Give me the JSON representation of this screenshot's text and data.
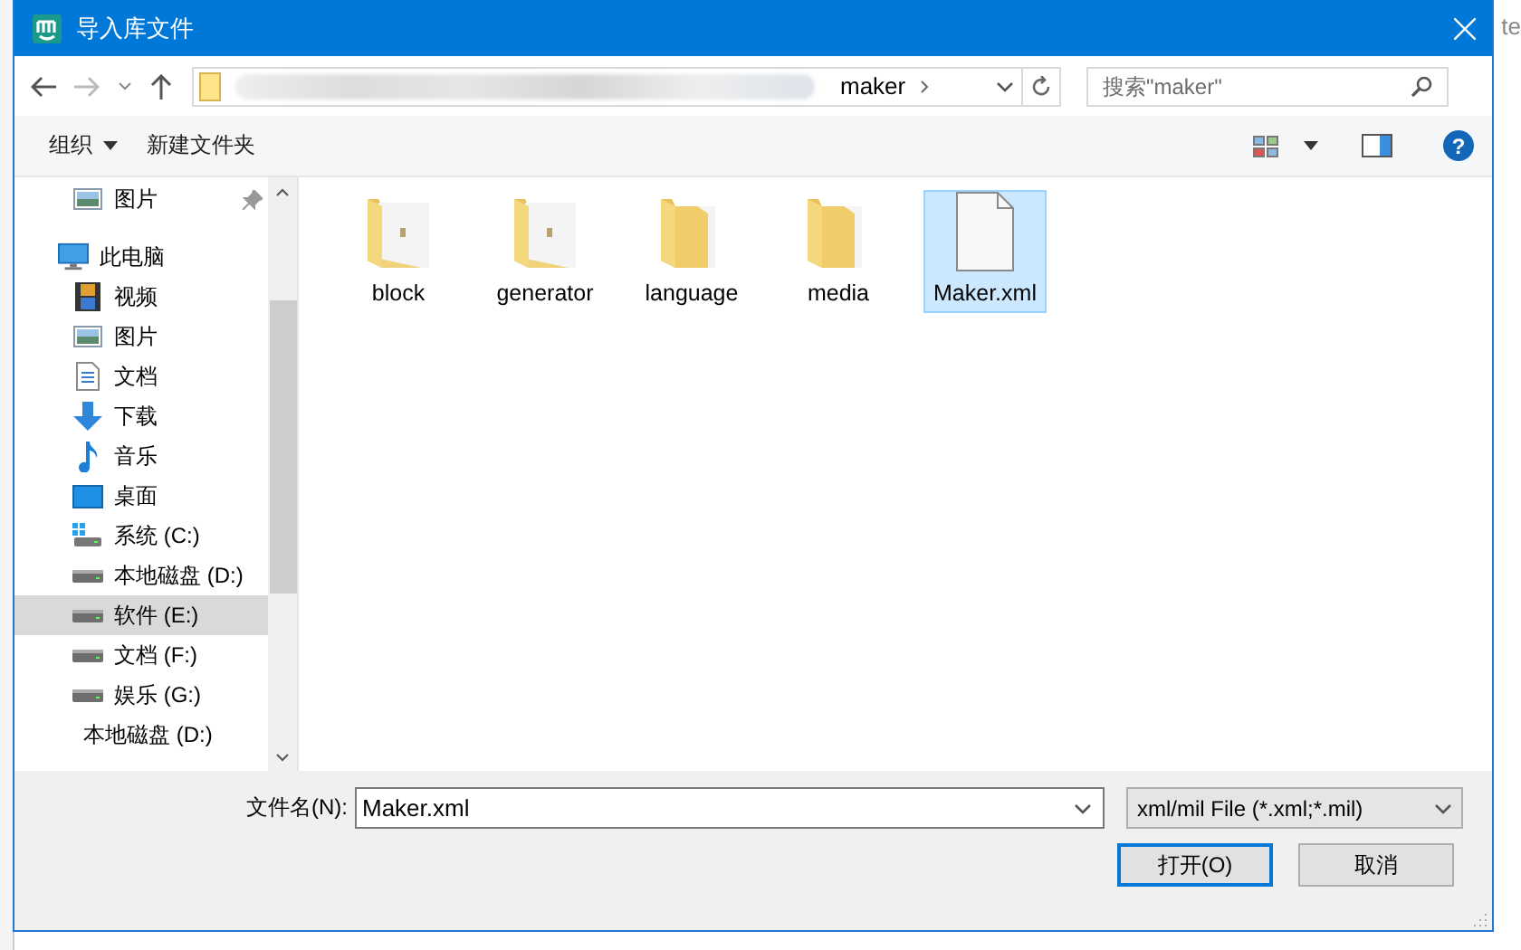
{
  "window": {
    "title": "导入库文件"
  },
  "background_text": "te",
  "address": {
    "current": "maker"
  },
  "search": {
    "placeholder": "搜索\"maker\""
  },
  "toolbar": {
    "organize": "组织",
    "new_folder": "新建文件夹",
    "help": "?"
  },
  "nav": [
    {
      "label": "图片",
      "kind": "picture",
      "pinned": true,
      "selected": false
    },
    {
      "label": "此电脑",
      "kind": "pc",
      "pinned": false,
      "selected": false,
      "children": [
        {
          "label": "视频",
          "kind": "video",
          "pinned": false,
          "selected": false
        },
        {
          "label": "图片",
          "kind": "picture",
          "pinned": false,
          "selected": false
        },
        {
          "label": "文档",
          "kind": "document",
          "pinned": false,
          "selected": false
        },
        {
          "label": "下载",
          "kind": "download",
          "pinned": false,
          "selected": false
        },
        {
          "label": "音乐",
          "kind": "music",
          "pinned": false,
          "selected": false
        },
        {
          "label": "桌面",
          "kind": "desktop",
          "pinned": false,
          "selected": false
        },
        {
          "label": "系统 (C:)",
          "kind": "system-drive",
          "pinned": false,
          "selected": false
        },
        {
          "label": "本地磁盘 (D:)",
          "kind": "drive",
          "pinned": false,
          "selected": false
        },
        {
          "label": "软件 (E:)",
          "kind": "drive",
          "pinned": false,
          "selected": true
        },
        {
          "label": "文档 (F:)",
          "kind": "drive",
          "pinned": false,
          "selected": false
        },
        {
          "label": "娱乐 (G:)",
          "kind": "drive",
          "pinned": false,
          "selected": false
        }
      ]
    },
    {
      "label": "本地磁盘 (D:)",
      "kind": "none",
      "pinned": false,
      "selected": false
    }
  ],
  "files": [
    {
      "name": "block",
      "kind": "folder-doc",
      "selected": false
    },
    {
      "name": "generator",
      "kind": "folder-doc",
      "selected": false
    },
    {
      "name": "language",
      "kind": "folder-pages",
      "selected": false
    },
    {
      "name": "media",
      "kind": "folder-pages",
      "selected": false
    },
    {
      "name": "Maker.xml",
      "kind": "file",
      "selected": true
    }
  ],
  "filename": {
    "label": "文件名(N):",
    "value": "Maker.xml"
  },
  "filetype": {
    "value": "xml/mil File (*.xml;*.mil)"
  },
  "buttons": [
    {
      "label": "打开(O)",
      "kind": "default"
    },
    {
      "label": "取消",
      "kind": "normal"
    }
  ]
}
